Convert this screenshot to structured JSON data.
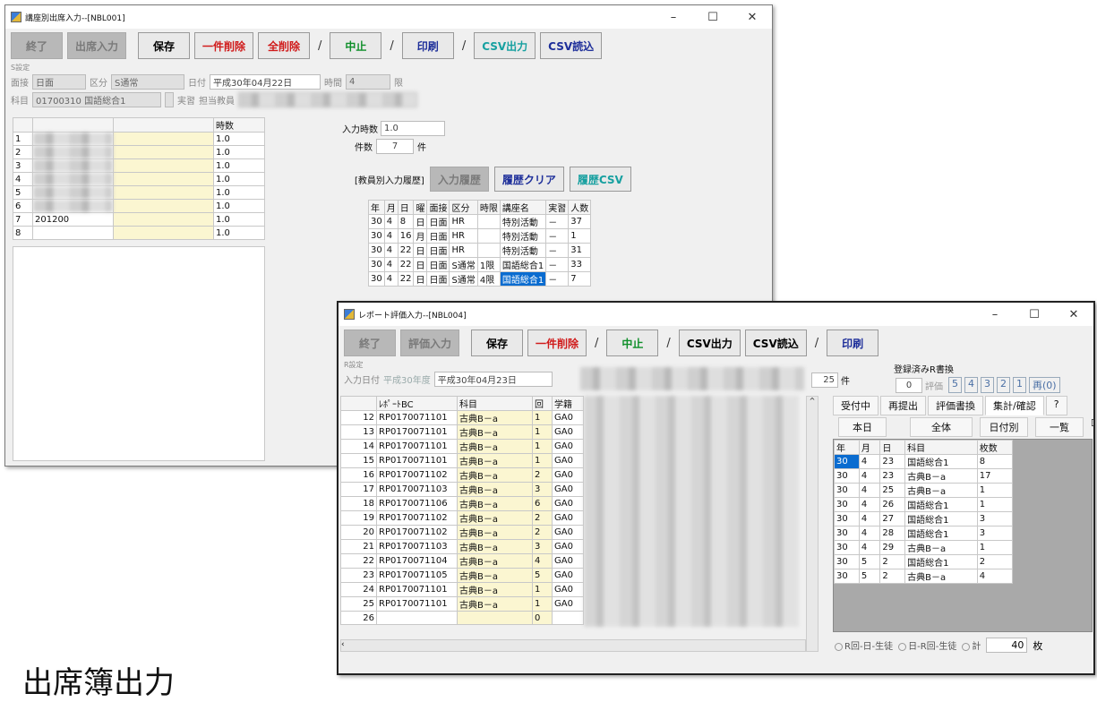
{
  "caption": "出席簿出力",
  "w1": {
    "title": "講座別出席入力--[NBL001]",
    "buttons": [
      "終了",
      "出席入力",
      "保存",
      "一件削除",
      "全削除",
      "中止",
      "印刷",
      "CSV出力",
      "CSV読込"
    ],
    "setting_label": "S設定",
    "f": {
      "l1": "面接",
      "v1": "日面",
      "l2": "区分",
      "v2": "S通常",
      "l3": "日付",
      "v3": "平成30年04月22日",
      "l4": "時間",
      "v4": "4",
      "l5": "限",
      "l6": "科目",
      "v6": "01700310 国語総合1",
      "l7": "実習",
      "l8": "担当教員"
    },
    "grid_header": "時数",
    "rows": [
      {
        "n": "1",
        "v": "1.0"
      },
      {
        "n": "2",
        "v": "1.0"
      },
      {
        "n": "3",
        "v": "1.0"
      },
      {
        "n": "4",
        "v": "1.0"
      },
      {
        "n": "5",
        "v": "1.0"
      },
      {
        "n": "6",
        "v": "1.0"
      },
      {
        "n": "7",
        "v": "1.0",
        "frag": "201200"
      },
      {
        "n": "8",
        "v": "1.0"
      }
    ],
    "inputs": {
      "l1": "入力時数",
      "v1": "1.0",
      "l2": "件数",
      "v2": "7",
      "l3": "件"
    },
    "history": {
      "label": "[教員別入力履歴]",
      "b1": "入力履歴",
      "b2": "履歴クリア",
      "b3": "履歴CSV"
    },
    "table": {
      "headers": [
        "年",
        "月",
        "日",
        "曜",
        "面接",
        "区分",
        "時限",
        "講座名",
        "実習",
        "人数"
      ],
      "rows": [
        [
          "30",
          "4",
          "8",
          "日",
          "日面",
          "HR",
          "",
          "特別活動",
          "－",
          "37"
        ],
        [
          "30",
          "4",
          "16",
          "月",
          "日面",
          "HR",
          "",
          "特別活動",
          "－",
          "1"
        ],
        [
          "30",
          "4",
          "22",
          "日",
          "日面",
          "HR",
          "",
          "特別活動",
          "－",
          "31"
        ],
        [
          "30",
          "4",
          "22",
          "日",
          "日面",
          "S通常",
          "1限",
          "国語総合1",
          "－",
          "33"
        ],
        [
          "30",
          "4",
          "22",
          "日",
          "日面",
          "S通常",
          "4限",
          "国語総合1",
          "－",
          "7"
        ]
      ]
    }
  },
  "w2": {
    "title": "レポート評価入力--[NBL004]",
    "buttons": [
      "終了",
      "評価入力",
      "保存",
      "一件削除",
      "中止",
      "CSV出力",
      "CSV読込",
      "印刷"
    ],
    "setting_label": "R設定",
    "f": {
      "l1": "入力日付",
      "v1": "平成30年度",
      "v2": "平成30年04月23日",
      "count": "25",
      "count_unit": "件",
      "reg_label": "登録済みR書換",
      "reg_val": "0",
      "eval_label": "評価",
      "evals": [
        "5",
        "4",
        "3",
        "2",
        "1",
        "再(0)"
      ]
    },
    "grid_headers": [
      "ﾚﾎﾟｰﾄBC",
      "科目",
      "回",
      "学籍"
    ],
    "rows": [
      {
        "n": "12",
        "bc": "RP0170071101",
        "s": "古典B－a",
        "k": "1",
        "g": "GA0"
      },
      {
        "n": "13",
        "bc": "RP0170071101",
        "s": "古典B－a",
        "k": "1",
        "g": "GA0"
      },
      {
        "n": "14",
        "bc": "RP0170071101",
        "s": "古典B－a",
        "k": "1",
        "g": "GA0"
      },
      {
        "n": "15",
        "bc": "RP0170071101",
        "s": "古典B－a",
        "k": "1",
        "g": "GA0"
      },
      {
        "n": "16",
        "bc": "RP0170071102",
        "s": "古典B－a",
        "k": "2",
        "g": "GA0"
      },
      {
        "n": "17",
        "bc": "RP0170071103",
        "s": "古典B－a",
        "k": "3",
        "g": "GA0"
      },
      {
        "n": "18",
        "bc": "RP0170071106",
        "s": "古典B－a",
        "k": "6",
        "g": "GA0"
      },
      {
        "n": "19",
        "bc": "RP0170071102",
        "s": "古典B－a",
        "k": "2",
        "g": "GA0"
      },
      {
        "n": "20",
        "bc": "RP0170071102",
        "s": "古典B－a",
        "k": "2",
        "g": "GA0"
      },
      {
        "n": "21",
        "bc": "RP0170071103",
        "s": "古典B－a",
        "k": "3",
        "g": "GA0"
      },
      {
        "n": "22",
        "bc": "RP0170071104",
        "s": "古典B－a",
        "k": "4",
        "g": "GA0"
      },
      {
        "n": "23",
        "bc": "RP0170071105",
        "s": "古典B－a",
        "k": "5",
        "g": "GA0"
      },
      {
        "n": "24",
        "bc": "RP0170071101",
        "s": "古典B－a",
        "k": "1",
        "g": "GA0"
      },
      {
        "n": "25",
        "bc": "RP0170071101",
        "s": "古典B－a",
        "k": "1",
        "g": "GA0"
      },
      {
        "n": "26",
        "bc": "",
        "s": "",
        "k": "0",
        "g": ""
      }
    ],
    "tabs": [
      "受付中",
      "再提出",
      "評価書換",
      "集計/確認",
      "?"
    ],
    "sub_buttons": [
      "本日",
      "全体",
      "日付別",
      "一覧"
    ],
    "right_headers": [
      "年",
      "月",
      "日",
      "科目",
      "枚数"
    ],
    "right_rows": [
      [
        "30",
        "4",
        "23",
        "国語総合1",
        "8"
      ],
      [
        "30",
        "4",
        "23",
        "古典B－a",
        "17"
      ],
      [
        "30",
        "4",
        "25",
        "古典B－a",
        "1"
      ],
      [
        "30",
        "4",
        "26",
        "国語総合1",
        "1"
      ],
      [
        "30",
        "4",
        "27",
        "国語総合1",
        "3"
      ],
      [
        "30",
        "4",
        "28",
        "国語総合1",
        "3"
      ],
      [
        "30",
        "4",
        "29",
        "古典B－a",
        "1"
      ],
      [
        "30",
        "5",
        "2",
        "国語総合1",
        "2"
      ],
      [
        "30",
        "5",
        "2",
        "古典B－a",
        "4"
      ]
    ],
    "bottom": {
      "r1": "R回-日-生徒",
      "r2": "日-R回-生徒",
      "r3": "計",
      "total": "40",
      "unit": "枚"
    }
  }
}
